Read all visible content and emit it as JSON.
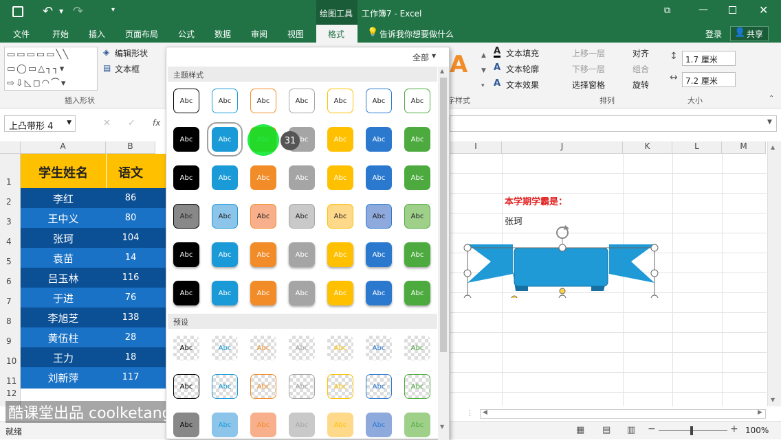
{
  "titlebar": {
    "context": "绘图工具",
    "title": "工作簿7 - Excel"
  },
  "tabs": [
    "文件",
    "开始",
    "插入",
    "页面布局",
    "公式",
    "数据",
    "审阅",
    "视图",
    "格式"
  ],
  "tell_me": "告诉我你想要做什么",
  "login": "登录",
  "share": "共享",
  "ribbon": {
    "edit_shape": "编辑形状",
    "text_box": "文本框",
    "insert_shapes": "插入形状",
    "text_fill": "文本填充",
    "text_outline": "文本轮廓",
    "text_effect": "文本效果",
    "art_styles": "艺术字样式",
    "bring_forward": "上移一层",
    "send_backward": "下移一层",
    "selection_pane": "选择窗格",
    "align": "对齐",
    "group": "组合",
    "rotate": "旋转",
    "arrange": "排列",
    "height": "1.7 厘米",
    "width": "7.2 厘米",
    "size": "大小"
  },
  "namebox": "上凸带形 4",
  "fx": "fx",
  "gallery": {
    "filter": "全部",
    "theme_styles": "主题样式",
    "presets": "预设",
    "abc": "Abc",
    "badge": "31"
  },
  "columns": [
    "A",
    "B",
    "I",
    "J",
    "K",
    "L",
    "M"
  ],
  "rows": [
    "1",
    "2",
    "3",
    "4",
    "5",
    "6",
    "7",
    "8",
    "9",
    "10",
    "11",
    "12"
  ],
  "table": {
    "headers": [
      "学生姓名",
      "语文"
    ],
    "rows": [
      [
        "李红",
        "86"
      ],
      [
        "王中义",
        "80"
      ],
      [
        "张珂",
        "104"
      ],
      [
        "袁苗",
        "14"
      ],
      [
        "吕玉林",
        "116"
      ],
      [
        "于进",
        "76"
      ],
      [
        "李旭芝",
        "138"
      ],
      [
        "黄伍柱",
        "28"
      ],
      [
        "王力",
        "18"
      ],
      [
        "刘新萍",
        "117"
      ]
    ]
  },
  "note": {
    "label": "本学期学霸是：",
    "value": "张珂"
  },
  "status": {
    "ready": "就绪",
    "zoom": "100%"
  },
  "watermark": "酷课堂出品 coolketang.com",
  "colors": {
    "accent": "#217346",
    "header_fill": "#ffc000",
    "row_dark": "#0b4f95",
    "row_light": "#1a72c6",
    "ribbon_shape": "#1f9ad6"
  }
}
